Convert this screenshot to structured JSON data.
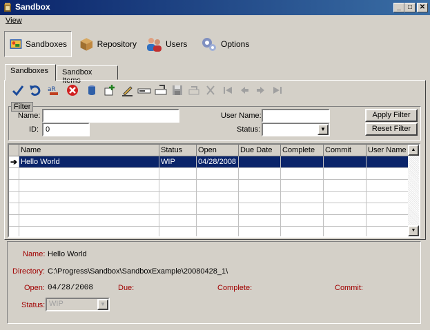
{
  "window": {
    "title": "Sandbox"
  },
  "menu": {
    "view": "View"
  },
  "nav": [
    {
      "label": "Sandboxes",
      "icon": "sandbox-icon"
    },
    {
      "label": "Repository",
      "icon": "repository-box-icon"
    },
    {
      "label": "Users",
      "icon": "users-icon"
    },
    {
      "label": "Options",
      "icon": "options-gears-icon"
    }
  ],
  "tabs": [
    "Sandboxes",
    "Sandbox Items"
  ],
  "toolbar_icons": [
    "check-icon",
    "undo-icon",
    "rename-icon",
    "delete-icon",
    "database-icon",
    "add-icon",
    "edit-icon",
    "field-icon",
    "move-icon",
    "save-icon",
    "export-icon",
    "cut-icon",
    "first-icon",
    "prev-icon",
    "next-icon",
    "last-icon"
  ],
  "filter": {
    "legend": "Filter",
    "name_label": "Name:",
    "name_value": "",
    "id_label": "ID:",
    "id_value": "0",
    "user_label": "User Name:",
    "user_value": "",
    "status_label": "Status:",
    "status_value": "",
    "apply": "Apply Filter",
    "reset": "Reset Filter"
  },
  "grid": {
    "columns": [
      "Name",
      "Status",
      "Open",
      "Due Date",
      "Complete",
      "Commit",
      "User Name"
    ],
    "rows": [
      [
        "Hello World",
        "WIP",
        "04/28/2008",
        "",
        "",
        "",
        ""
      ]
    ]
  },
  "detail": {
    "name_label": "Name:",
    "name_value": "Hello World",
    "dir_label": "Directory:",
    "dir_value": "C:\\Progress\\Sandbox\\SandboxExample\\20080428_1\\",
    "open_label": "Open:",
    "open_value": "04/28/2008",
    "due_label": "Due:",
    "complete_label": "Complete:",
    "commit_label": "Commit:",
    "status_label": "Status:",
    "status_value": "WIP"
  },
  "colors": {
    "title_start": "#0a246a",
    "title_end": "#3a6ea5",
    "selection": "#0a246a",
    "label_red": "#a00000"
  }
}
